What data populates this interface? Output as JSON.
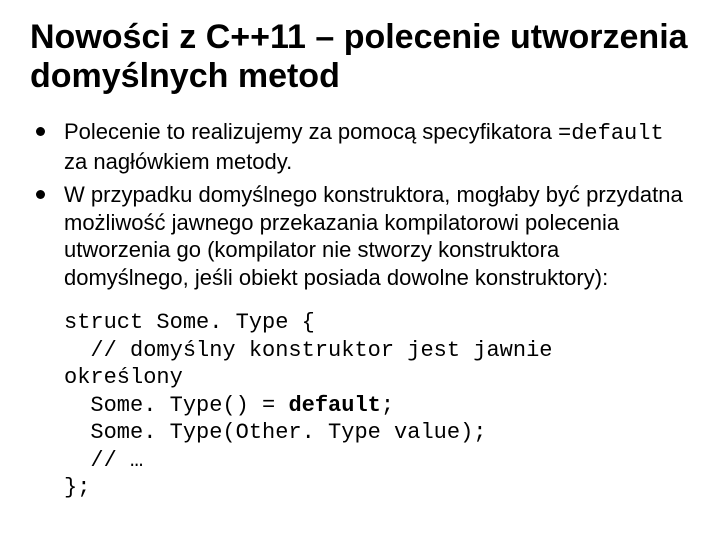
{
  "title": "Nowości z C++11 – polecenie utworzenia domyślnych metod",
  "bullets": [
    {
      "pre": "Polecenie to realizujemy za pomocą specyfikatora ",
      "code": "=default",
      "post": " za nagłówkiem metody."
    },
    {
      "pre": "W przypadku domyślnego konstruktora, mogłaby być przydatna możliwość jawnego przekazania kompilatorowi polecenia utworzenia go (kompilator nie stworzy konstruktora domyślnego, jeśli obiekt posiada dowolne konstruktory):",
      "code": "",
      "post": ""
    }
  ],
  "code": {
    "l1": "struct Some. Type {",
    "l2": "  // domyślny konstruktor jest jawnie",
    "l3": "określony",
    "l4a": "  Some. Type() = ",
    "l4b": "default",
    "l4c": ";",
    "l5": "  Some. Type(Other. Type value);",
    "l6": "  // …",
    "l7": "};"
  }
}
